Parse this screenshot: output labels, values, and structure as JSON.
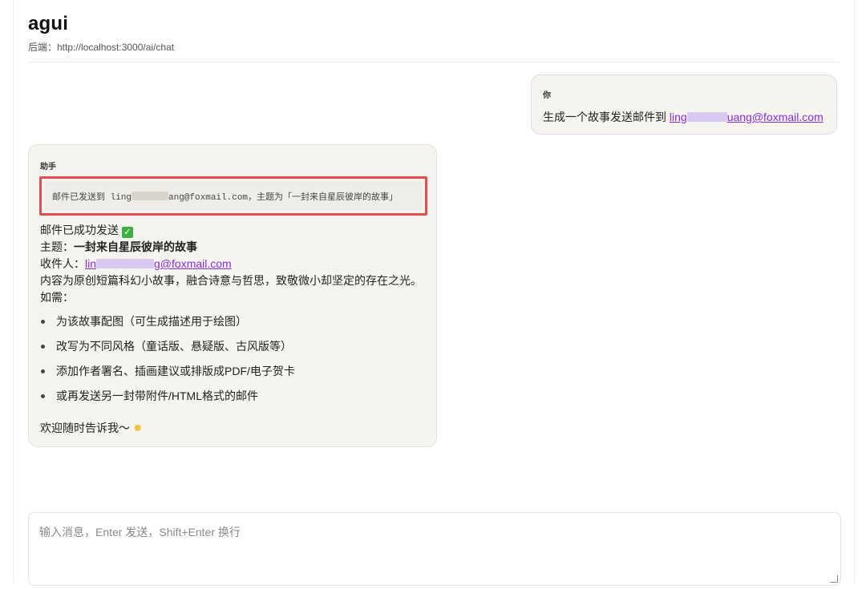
{
  "app": {
    "title": "agui",
    "backend_label": "后端：http://localhost:3000/ai/chat"
  },
  "user_message": {
    "role": "你",
    "text_prefix": "生成一个故事发送邮件到 ",
    "email_start": "ling",
    "email_end": "uang@foxmail.com"
  },
  "assistant_message": {
    "role": "助手",
    "status_prefix": "邮件已发送到 ling",
    "status_suffix": "ang@foxmail.com，主题为「一封来自星辰彼岸的故事」",
    "sent_line": "邮件已成功发送",
    "sent_icon": "✅",
    "subject_label": "主题：",
    "subject_value": "一封来自星辰彼岸的故事",
    "recipient_label": "收件人：",
    "recipient_start": "lin",
    "recipient_end": "g@foxmail.com",
    "content_line": "内容为原创短篇科幻小故事，融合诗意与哲思，致敬微小却坚定的存在之光。",
    "if_needed": "如需：",
    "suggestions": [
      "为该故事配图（可生成描述用于绘图）",
      "改写为不同风格（童话版、悬疑版、古风版等）",
      "添加作者署名、插画建议或排版成PDF/电子贺卡",
      "或再发送另一封带附件/HTML格式的邮件"
    ],
    "welcome": "欢迎随时告诉我～",
    "welcome_icon": "🌟"
  },
  "composer": {
    "placeholder": "输入消息，Enter 发送，Shift+Enter 换行",
    "value": ""
  },
  "colors": {
    "link": "#8a2be2",
    "highlight_border": "#e84d4d",
    "bubble_bg": "#f6f4ef"
  }
}
